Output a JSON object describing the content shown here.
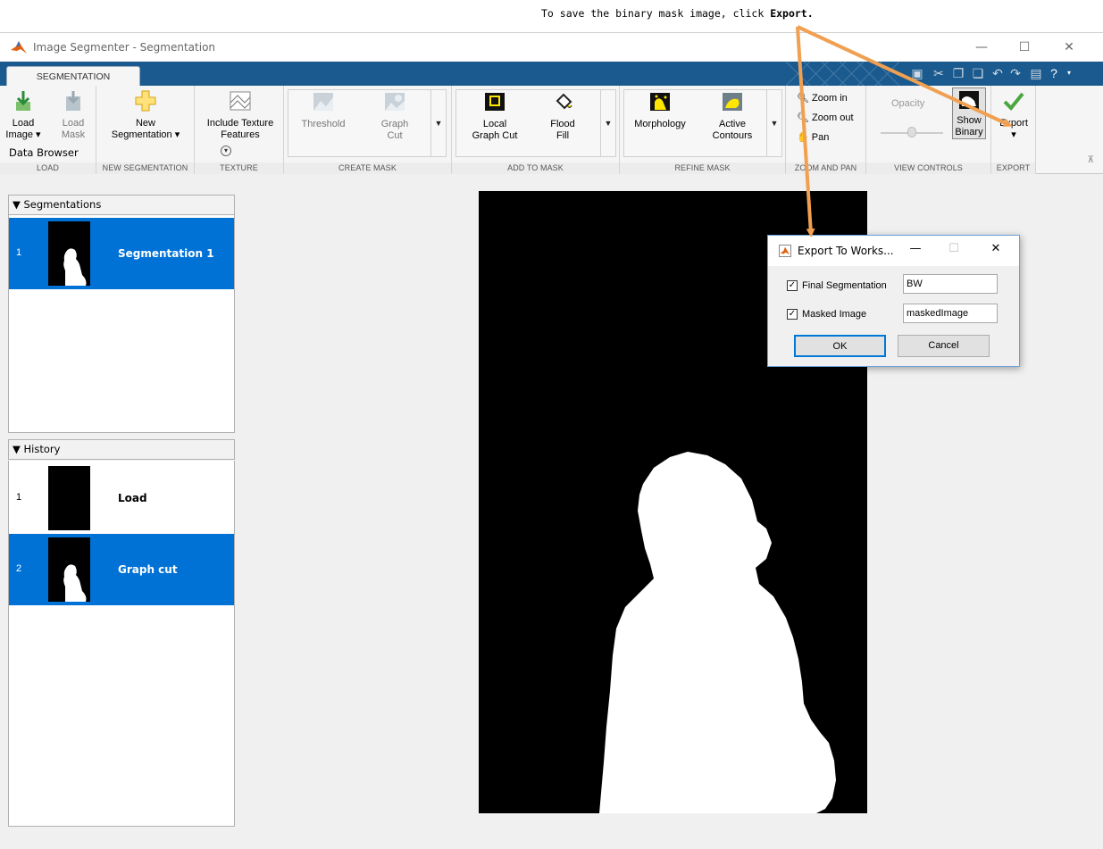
{
  "annotation": {
    "text_prefix": "To save the binary mask image, click ",
    "text_bold": "Export."
  },
  "window": {
    "title": "Image Segmenter - Segmentation",
    "minimize": "—",
    "maximize": "☐",
    "close": "✕"
  },
  "tabs": [
    {
      "label": "SEGMENTATION"
    }
  ],
  "ribbon": {
    "groups": {
      "load": "LOAD",
      "new_segmentation": "NEW SEGMENTATION",
      "texture": "TEXTURE",
      "create_mask": "CREATE MASK",
      "add_to_mask": "ADD TO MASK",
      "refine_mask": "REFINE MASK",
      "zoom_and_pan": "ZOOM AND PAN",
      "view_controls": "VIEW CONTROLS",
      "export": "EXPORT"
    },
    "buttons": {
      "load_image": "Load\nImage ▾",
      "load_mask": "Load\nMask",
      "new_segmentation": "New\nSegmentation ▾",
      "include_texture": "Include Texture\nFeatures",
      "threshold": "Threshold",
      "graph_cut": "Graph\nCut",
      "local_graph_cut": "Local\nGraph Cut",
      "flood_fill": "Flood\nFill",
      "morphology": "Morphology",
      "active_contours": "Active\nContours",
      "zoom_in": "Zoom in",
      "zoom_out": "Zoom out",
      "pan": "Pan",
      "opacity": "Opacity",
      "show_binary": "Show\nBinary",
      "export": "Export\n▾"
    }
  },
  "data_browser": {
    "title": "Data Browser"
  },
  "segmentations": {
    "header": "Segmentations",
    "items": [
      {
        "num": "1",
        "name": "Segmentation 1"
      }
    ]
  },
  "history": {
    "header": "History",
    "items": [
      {
        "num": "1",
        "name": "Load"
      },
      {
        "num": "2",
        "name": "Graph cut"
      }
    ]
  },
  "dialog": {
    "title": "Export To Works...",
    "min": "—",
    "max": "☐",
    "close": "✕",
    "final_segmentation_label": "Final Segmentation",
    "final_segmentation_value": "BW",
    "final_segmentation_checked": true,
    "masked_image_label": "Masked Image",
    "masked_image_value": "maskedImage",
    "masked_image_checked": true,
    "ok": "OK",
    "cancel": "Cancel"
  },
  "colors": {
    "accent": "#0072d6",
    "tabstrip": "#1a5a8e",
    "annotation_arrow": "#f0a050",
    "canvas": "#000000",
    "mask": "#ffffff"
  }
}
